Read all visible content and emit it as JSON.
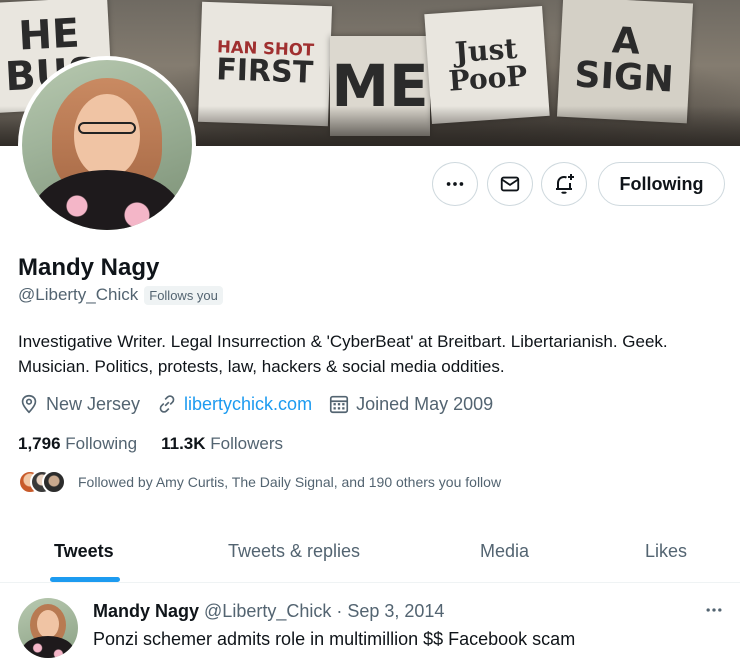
{
  "banner": {
    "signs": [
      {
        "text": "HE BUS"
      },
      {
        "top": "HAN SHOT",
        "bottom": "FIRST"
      },
      {
        "text": "ME"
      },
      {
        "text": "Just PooP"
      },
      {
        "text": "A SIGN"
      }
    ]
  },
  "profile": {
    "name": "Mandy Nagy",
    "handle": "@Liberty_Chick",
    "follows_you": "Follows you",
    "bio": "Investigative Writer. Legal Insurrection & 'CyberBeat' at Breitbart. Libertarianish. Geek. Musician. Politics, protests, law, hackers & social media oddities.",
    "location": "New Jersey",
    "website": "libertychick.com",
    "joined": "Joined May 2009",
    "following_count": "1,796",
    "following_label": "Following",
    "followers_count": "11.3K",
    "followers_label": "Followers",
    "followed_by": "Followed by Amy Curtis, The Daily Signal, and 190 others you follow"
  },
  "actions": {
    "following_button": "Following",
    "icons": [
      "more-icon",
      "mail-icon",
      "bell-plus-icon"
    ]
  },
  "tabs": [
    {
      "label": "Tweets",
      "active": true
    },
    {
      "label": "Tweets & replies",
      "active": false
    },
    {
      "label": "Media",
      "active": false
    },
    {
      "label": "Likes",
      "active": false
    }
  ],
  "tweet": {
    "name": "Mandy Nagy",
    "handle": "@Liberty_Chick",
    "separator": "·",
    "date": "Sep 3, 2014",
    "text": "Ponzi schemer admits role in multimillion $$ Facebook scam"
  },
  "colors": {
    "accent": "#1d9bf0",
    "text_primary": "#0f1419",
    "text_secondary": "#536471",
    "border": "#cfd9de"
  }
}
